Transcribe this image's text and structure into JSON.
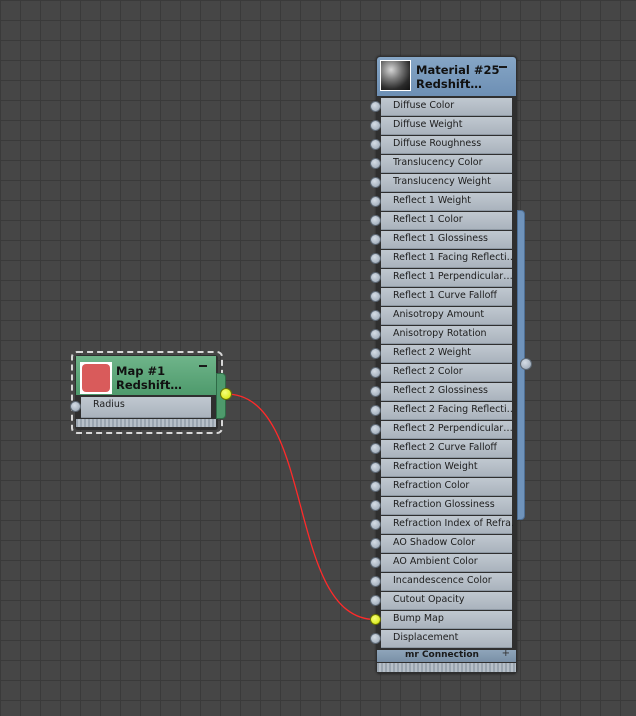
{
  "material_node": {
    "title_line1": "Material #25",
    "title_line2": "Redshift…",
    "icon": "material-sphere-icon",
    "inputs": [
      "Diffuse Color",
      "Diffuse Weight",
      "Diffuse Roughness",
      "Translucency Color",
      "Translucency Weight",
      "Reflect 1 Weight",
      "Reflect 1 Color",
      "Reflect 1 Glossiness",
      "Reflect 1 Facing Reflecti…",
      "Reflect 1 Perpendicular…",
      "Reflect 1 Curve Falloff",
      "Anisotropy Amount",
      "Anisotropy Rotation",
      "Reflect 2 Weight",
      "Reflect 2 Color",
      "Reflect 2 Glossiness",
      "Reflect 2 Facing Reflecti…",
      "Reflect 2 Perpendicular…",
      "Reflect 2 Curve Falloff",
      "Refraction Weight",
      "Refraction Color",
      "Refraction Glossiness",
      "Refraction Index of Refra…",
      "AO Shadow Color",
      "AO Ambient Color",
      "Incandescence Color",
      "Cutout Opacity",
      "Bump Map",
      "Displacement"
    ],
    "connected_input": "Bump Map",
    "footer_label": "mr Connection",
    "footer_plus": "+"
  },
  "map_node": {
    "title_line1": "Map #1",
    "title_line2": "Redshift…",
    "swatch_color": "#d95b5b",
    "inputs": [
      "Radius"
    ]
  },
  "colors": {
    "material_header": "#7a9bbd",
    "map_header": "#5ea87b",
    "wire": "#ff2a2a",
    "active_socket": "#e4f000"
  }
}
